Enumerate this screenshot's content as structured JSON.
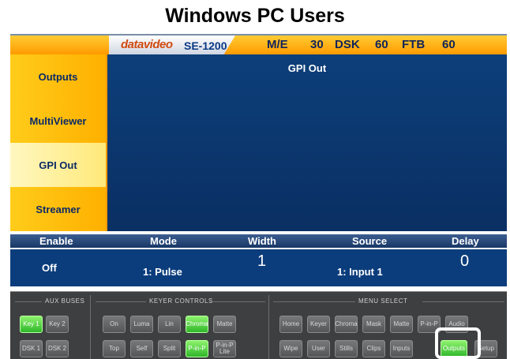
{
  "page_title": "Windows PC Users",
  "header": {
    "brand": "datavideo",
    "model": "SE-1200",
    "status": [
      {
        "label": "M/E"
      },
      {
        "label": "30"
      },
      {
        "label": "DSK"
      },
      {
        "label": "60"
      },
      {
        "label": "FTB"
      },
      {
        "label": "60"
      }
    ]
  },
  "sidebar": {
    "items": [
      {
        "label": "Outputs"
      },
      {
        "label": "MultiViewer"
      },
      {
        "label": "GPI Out"
      },
      {
        "label": "Streamer"
      }
    ],
    "active": "GPI Out"
  },
  "panel": {
    "title": "GPI Out"
  },
  "settings": {
    "headers": {
      "enable": "Enable",
      "mode": "Mode",
      "width": "Width",
      "source": "Source",
      "delay": "Delay"
    },
    "values": {
      "enable": "Off",
      "mode": "1: Pulse",
      "width": "1",
      "source": "1: Input 1",
      "delay": "0"
    }
  },
  "controls": {
    "aux_buses": {
      "label": "AUX BUSES",
      "buttons": [
        {
          "label": "Key 1",
          "active": true
        },
        {
          "label": "Key 2",
          "active": false
        },
        {
          "label": "DSK 1",
          "active": false
        },
        {
          "label": "DSK 2",
          "active": false
        }
      ]
    },
    "keyer_controls": {
      "label": "KEYER CONTROLS",
      "buttons": [
        {
          "label": "On",
          "active": false
        },
        {
          "label": "Luma",
          "active": false
        },
        {
          "label": "Lin",
          "active": false
        },
        {
          "label": "Chroma",
          "active": true
        },
        {
          "label": "Matte",
          "active": false
        },
        {
          "label": "Top",
          "active": false
        },
        {
          "label": "Self",
          "active": false
        },
        {
          "label": "Split",
          "active": false
        },
        {
          "label": "P-in-P",
          "active": true
        },
        {
          "label": "P-in-P Lite",
          "active": false
        }
      ]
    },
    "menu_select": {
      "label": "MENU SELECT",
      "buttons": [
        {
          "label": "Home",
          "active": false
        },
        {
          "label": "Keyer",
          "active": false
        },
        {
          "label": "Chroma",
          "active": false
        },
        {
          "label": "Mask",
          "active": false
        },
        {
          "label": "Matte",
          "active": false
        },
        {
          "label": "P-in-P",
          "active": false
        },
        {
          "label": "Audio",
          "active": false
        },
        {
          "label": "Wipe",
          "active": false
        },
        {
          "label": "User",
          "active": false
        },
        {
          "label": "Stills",
          "active": false
        },
        {
          "label": "Clips",
          "active": false
        },
        {
          "label": "Inputs",
          "active": false
        },
        {
          "label": "Outputs",
          "active": true
        },
        {
          "label": "Setup",
          "active": false
        }
      ]
    }
  },
  "colors": {
    "accent_orange": "#ff9a00",
    "panel_blue": "#0b3d7c",
    "active_green": "#2fb62a",
    "highlight_white": "#ffffff"
  }
}
